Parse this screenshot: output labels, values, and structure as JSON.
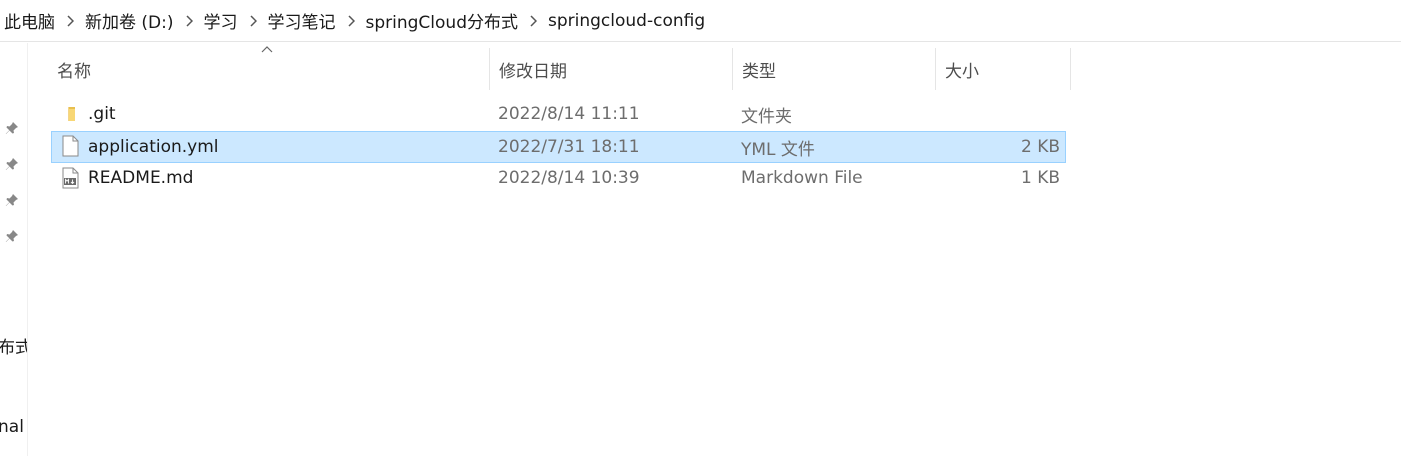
{
  "breadcrumb": {
    "items": [
      "此电脑",
      "新加卷 (D:)",
      "学习",
      "学习笔记",
      "springCloud分布式",
      "springcloud-config"
    ]
  },
  "nav_pane": {
    "partial_texts": [
      "布式",
      "nal"
    ]
  },
  "columns": {
    "name": "名称",
    "date": "修改日期",
    "type": "类型",
    "size": "大小"
  },
  "files": [
    {
      "name": ".git",
      "date": "2022/8/14 11:11",
      "type": "文件夹",
      "size": "",
      "icon": "folder-icon",
      "selected": false
    },
    {
      "name": "application.yml",
      "date": "2022/7/31 18:11",
      "type": "YML 文件",
      "size": "2 KB",
      "icon": "file-icon",
      "selected": true
    },
    {
      "name": "README.md",
      "date": "2022/8/14 10:39",
      "type": "Markdown File",
      "size": "1 KB",
      "icon": "markdown-file-icon",
      "selected": false
    }
  ],
  "colors": {
    "selection_bg": "#cce8ff",
    "selection_border": "#99d1ff",
    "folder": "#f8d775"
  }
}
